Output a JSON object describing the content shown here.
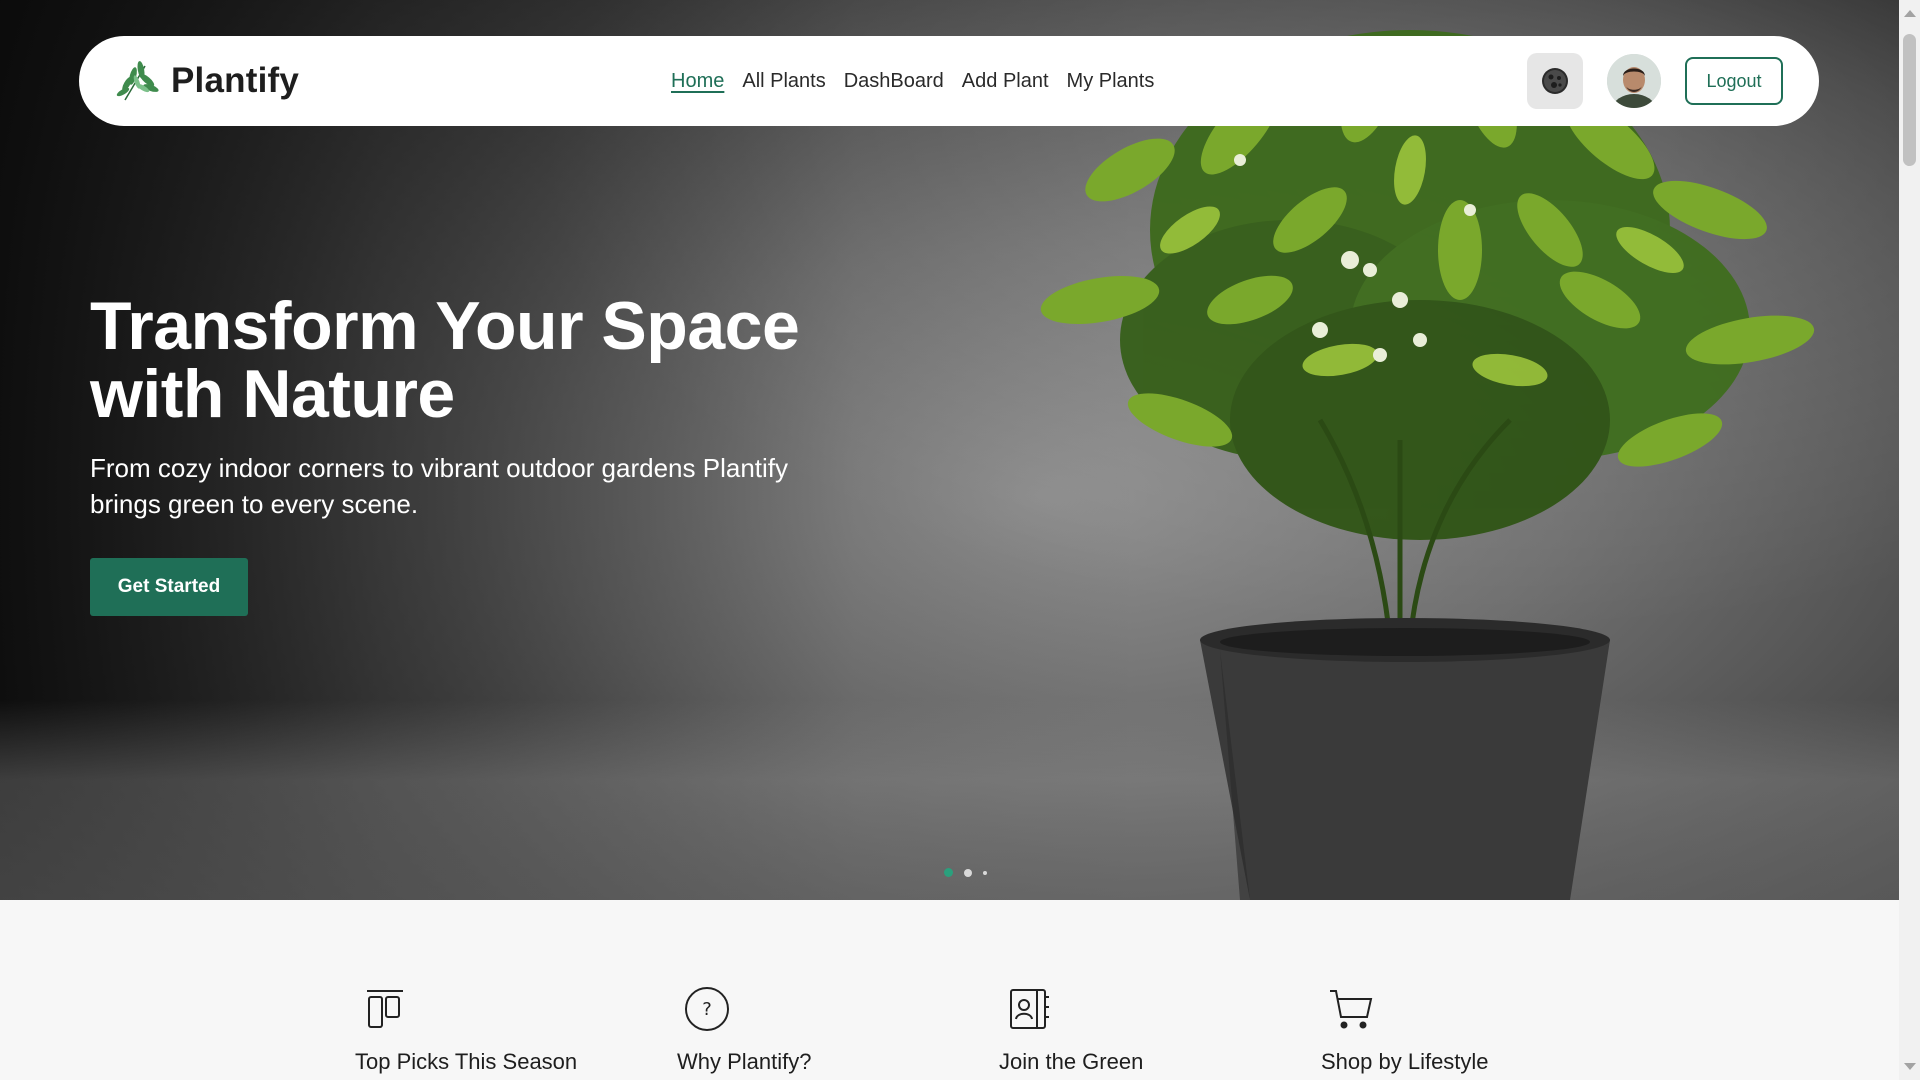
{
  "brand": {
    "name": "Plantify",
    "logo_icon": "leaf-sprig-icon"
  },
  "nav": {
    "links": [
      {
        "label": "Home",
        "active": true
      },
      {
        "label": "All Plants",
        "active": false
      },
      {
        "label": "DashBoard",
        "active": false
      },
      {
        "label": "Add Plant",
        "active": false
      },
      {
        "label": "My Plants",
        "active": false
      }
    ],
    "theme_toggle_icon": "theme-toggle-icon",
    "logout_label": "Logout"
  },
  "hero": {
    "title_line1": "Transform Your Space",
    "title_line2": "with Nature",
    "subtitle": "From cozy indoor corners to vibrant outdoor gardens Plantify brings green to every scene.",
    "cta_label": "Get Started",
    "slides_count": 3,
    "active_slide": 1
  },
  "features": [
    {
      "label": "Top Picks This Season",
      "icon": "columns-icon"
    },
    {
      "label": "Why Plantify?",
      "icon": "question-circle-icon"
    },
    {
      "label": "Join the Green",
      "icon": "contact-book-icon"
    },
    {
      "label": "Shop by Lifestyle",
      "icon": "shopping-cart-icon"
    }
  ],
  "colors": {
    "accent": "#1f6f57",
    "active_dot": "#2aa07d",
    "navbar_bg": "#ffffff",
    "page_bg": "#f7f7f7"
  }
}
